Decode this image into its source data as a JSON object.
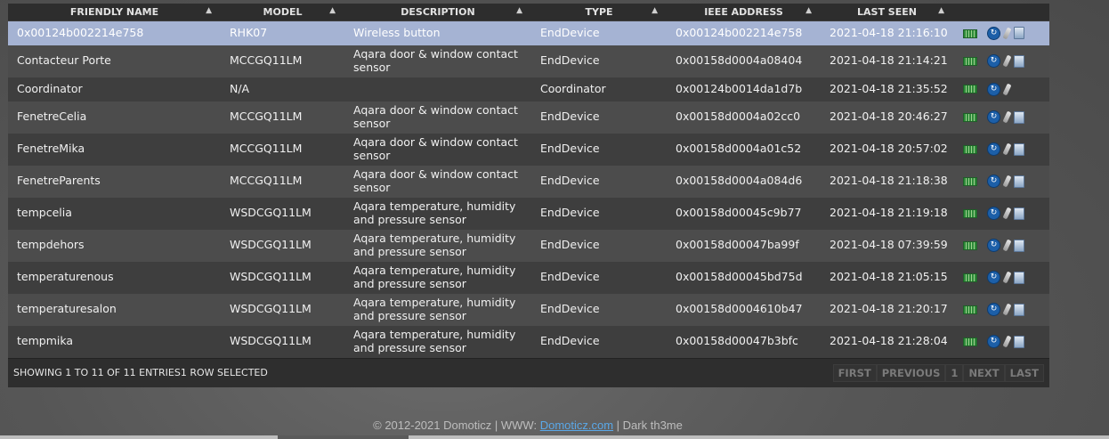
{
  "table": {
    "columns": [
      {
        "label": "FRIENDLY NAME",
        "sort": "▲"
      },
      {
        "label": "MODEL",
        "sort": "▲"
      },
      {
        "label": "DESCRIPTION",
        "sort": "▲"
      },
      {
        "label": "TYPE",
        "sort": "▲"
      },
      {
        "label": "IEEE ADDRESS",
        "sort": "▲"
      },
      {
        "label": "LAST SEEN",
        "sort": "▲"
      }
    ],
    "rows": [
      {
        "name": "0x00124b002214e758",
        "model": "RHK07",
        "desc": "Wireless button",
        "type": "EndDevice",
        "ieee": "0x00124b002214e758",
        "seen": "2021-04-18 21:16:10"
      },
      {
        "name": "Contacteur Porte",
        "model": "MCCGQ11LM",
        "desc": "Aqara door & window contact sensor",
        "type": "EndDevice",
        "ieee": "0x00158d0004a08404",
        "seen": "2021-04-18 21:14:21"
      },
      {
        "name": "Coordinator",
        "model": "N/A",
        "desc": "",
        "type": "Coordinator",
        "ieee": "0x00124b0014da1d7b",
        "seen": "2021-04-18 21:35:52"
      },
      {
        "name": "FenetreCelia",
        "model": "MCCGQ11LM",
        "desc": "Aqara door & window contact sensor",
        "type": "EndDevice",
        "ieee": "0x00158d0004a02cc0",
        "seen": "2021-04-18 20:46:27"
      },
      {
        "name": "FenetreMika",
        "model": "MCCGQ11LM",
        "desc": "Aqara door & window contact sensor",
        "type": "EndDevice",
        "ieee": "0x00158d0004a01c52",
        "seen": "2021-04-18 20:57:02"
      },
      {
        "name": "FenetreParents",
        "model": "MCCGQ11LM",
        "desc": "Aqara door & window contact sensor",
        "type": "EndDevice",
        "ieee": "0x00158d0004a084d6",
        "seen": "2021-04-18 21:18:38"
      },
      {
        "name": "tempcelia",
        "model": "WSDCGQ11LM",
        "desc": "Aqara temperature, humidity and pressure sensor",
        "type": "EndDevice",
        "ieee": "0x00158d00045c9b77",
        "seen": "2021-04-18 21:19:18"
      },
      {
        "name": "tempdehors",
        "model": "WSDCGQ11LM",
        "desc": "Aqara temperature, humidity and pressure sensor",
        "type": "EndDevice",
        "ieee": "0x00158d00047ba99f",
        "seen": "2021-04-18 07:39:59"
      },
      {
        "name": "temperaturenous",
        "model": "WSDCGQ11LM",
        "desc": "Aqara temperature, humidity and pressure sensor",
        "type": "EndDevice",
        "ieee": "0x00158d00045bd75d",
        "seen": "2021-04-18 21:05:15"
      },
      {
        "name": "temperaturesalon",
        "model": "WSDCGQ11LM",
        "desc": "Aqara temperature, humidity and pressure sensor",
        "type": "EndDevice",
        "ieee": "0x00158d0004610b47",
        "seen": "2021-04-18 21:20:17"
      },
      {
        "name": "tempmika",
        "model": "WSDCGQ11LM",
        "desc": "Aqara temperature, humidity and pressure sensor",
        "type": "EndDevice",
        "ieee": "0x00158d00047b3bfc",
        "seen": "2021-04-18 21:28:04"
      }
    ]
  },
  "footer": {
    "info": "SHOWING 1 TO 11 OF 11 ENTRIES1 ROW SELECTED",
    "pager": {
      "first": "FIRST",
      "previous": "PREVIOUS",
      "page": "1",
      "next": "NEXT",
      "last": "LAST"
    }
  },
  "copyright": {
    "prefix": "© 2012-2021 Domoticz | WWW: ",
    "link": "Domoticz.com",
    "suffix": " | Dark th3me"
  },
  "icons": {
    "signal": "signal-icon",
    "refresh": "refresh-icon",
    "edit": "edit-icon",
    "delete": "trash-icon"
  },
  "colors": {
    "selected_row": "#a5b3d3",
    "header_bg": "#2d2d2d",
    "link": "#5aa8e8"
  }
}
